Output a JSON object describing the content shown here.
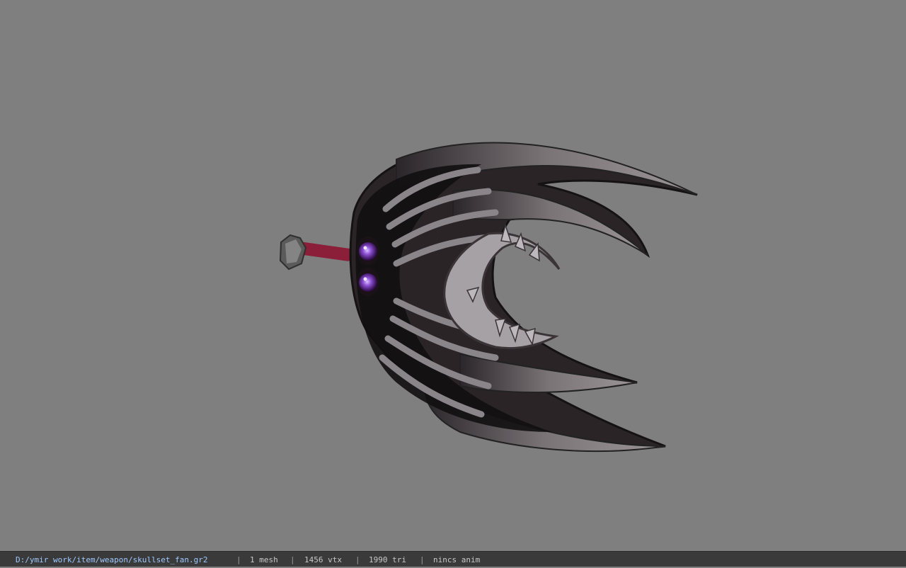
{
  "viewport": {
    "background": "#7f7f7f",
    "model_name": "skull fan weapon model"
  },
  "statusbar": {
    "path": "D:/ymir work/item/weapon/skullset_fan.gr2",
    "separator": "|",
    "mesh_count": "1 mesh",
    "vertex_count": "1456 vtx",
    "triangle_count": "1990 tri",
    "anim_status": "nincs anim"
  }
}
